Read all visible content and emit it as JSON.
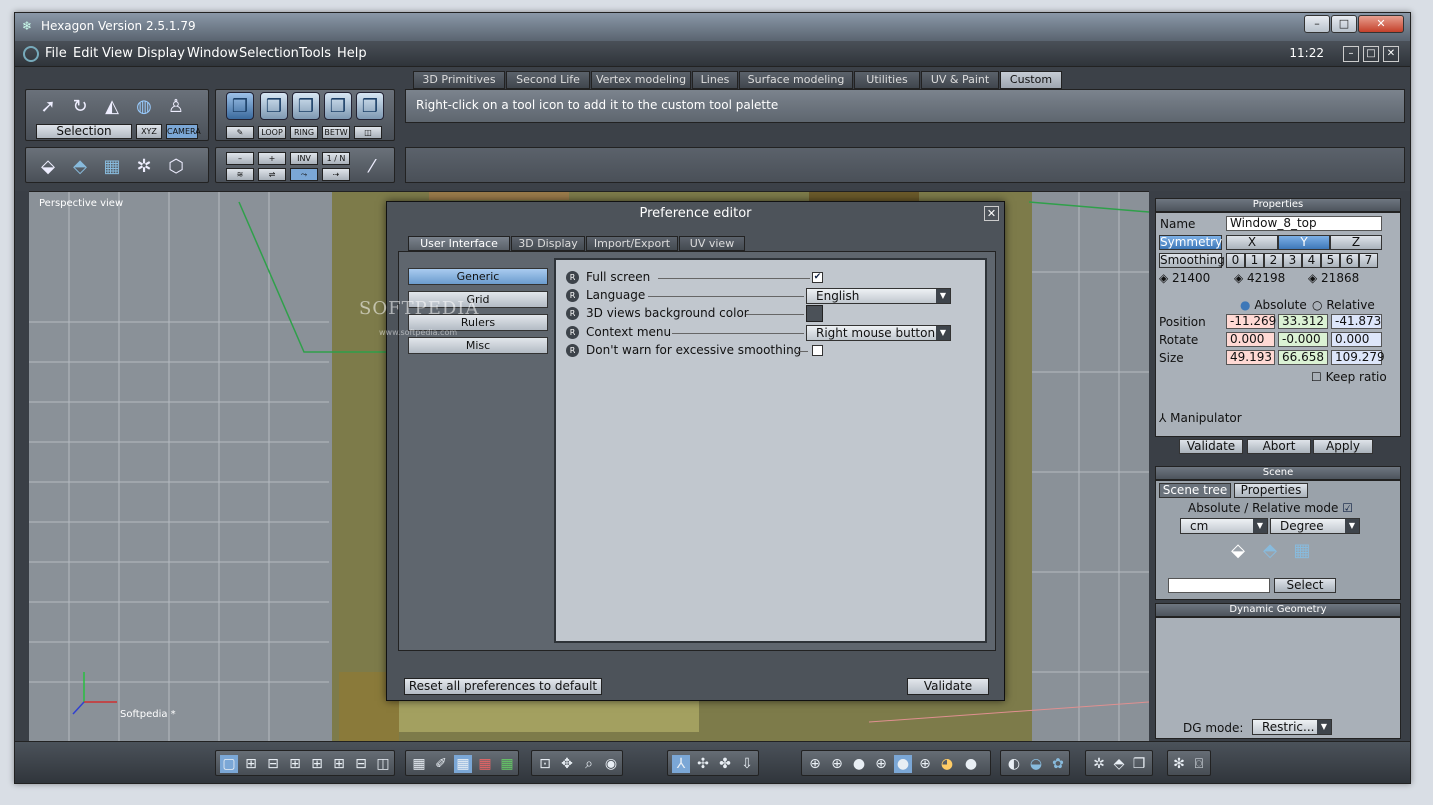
{
  "window": {
    "title": "Hexagon Version 2.5.1.79",
    "min_glyph": "–",
    "max_glyph": "□",
    "close_glyph": "✕"
  },
  "menubar": {
    "items": [
      "File",
      "Edit",
      "View",
      "Display",
      "Window",
      "Selection",
      "Tools",
      "Help"
    ],
    "clock": "11:22",
    "min_glyph": "–",
    "max_glyph": "□",
    "close_glyph": "✕"
  },
  "tabs": [
    "3D Primitives",
    "Second Life",
    "Vertex modeling",
    "Lines",
    "Surface modeling",
    "Utilities",
    "UV & Paint",
    "Custom"
  ],
  "hint_text": "Right-click on a tool icon to add it to the custom tool palette",
  "toolpalette": {
    "selection_label": "Selection",
    "xyz": "XYZ",
    "camera": "CAMERA",
    "loop": "LOOP",
    "ring": "RING",
    "betw": "BETW",
    "minus": "–",
    "plus": "+",
    "inv": "INV",
    "one_n": "1 / N"
  },
  "viewport": {
    "title": "Perspective view",
    "axis_label": "Softpedia *",
    "watermark": "SOFTPEDIA",
    "watermark_url": "www.softpedia.com"
  },
  "properties": {
    "header": "Properties",
    "name_label": "Name",
    "name_value": "Window_8_top",
    "symmetry": "Symmetry",
    "sym_x": "X",
    "sym_y": "Y",
    "sym_z": "Z",
    "smoothing": "Smoothing",
    "smooth_levels": [
      "0",
      "1",
      "2",
      "3",
      "4",
      "5",
      "6",
      "7"
    ],
    "counts": [
      "21400",
      "42198",
      "21868"
    ],
    "absolute": "Absolute",
    "relative": "Relative",
    "position_label": "Position",
    "position": [
      "-11.269",
      "33.312",
      "-41.873"
    ],
    "rotate_label": "Rotate",
    "rotate": [
      "0.000",
      "-0.000",
      "0.000"
    ],
    "size_label": "Size",
    "size": [
      "49.193",
      "66.658",
      "109.279"
    ],
    "keep_ratio": "Keep ratio",
    "manipulator": "Manipulator",
    "validate": "Validate",
    "abort": "Abort",
    "apply": "Apply"
  },
  "scene": {
    "header": "Scene",
    "tab_tree": "Scene tree",
    "tab_props": "Properties",
    "abs_rel": "Absolute / Relative mode",
    "unit": "cm",
    "angle": "Degree",
    "select": "Select"
  },
  "dyngeo": {
    "header": "Dynamic Geometry",
    "dg_mode": "DG mode:",
    "dg_value": "Restric..."
  },
  "dialog": {
    "title": "Preference editor",
    "close_glyph": "✕",
    "tabs": [
      "User Interface",
      "3D Display",
      "Import/Export",
      "UV view"
    ],
    "categories": [
      "Generic",
      "Grid",
      "Rulers",
      "Misc"
    ],
    "options": {
      "fullscreen": "Full screen",
      "language": "Language",
      "bgcolor": "3D views background color",
      "context": "Context menu",
      "smoothing": "Don't warn for excessive smoothing"
    },
    "badge": "R",
    "language_value": "English",
    "context_value": "Right mouse button",
    "reset": "Reset all preferences to default",
    "validate": "Validate"
  },
  "colors": {
    "accent": "#3e78b8",
    "bg_swatch": "#4b5158"
  }
}
